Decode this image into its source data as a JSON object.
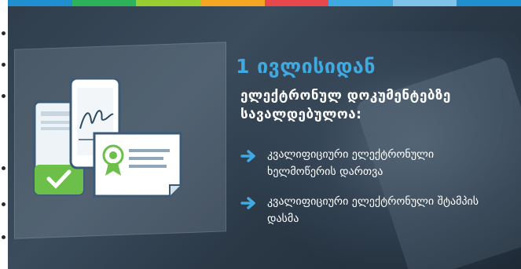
{
  "slide": {
    "title": "1 ივლისიდან",
    "subtitle": "ელექტრონულ დოკუმენტებზე სავალდებულოა:",
    "items": [
      {
        "label": "კვალიფიციური ელექტრონული ხელმოწერის დართვა"
      },
      {
        "label": "კვალიფიციური ელექტრონული შტამპის დასმა"
      }
    ],
    "accent_color": "#3fa9e0",
    "stripe_colors": [
      "#1f8fd0",
      "#2db15b",
      "#9acd32",
      "#f5a623",
      "#e8474c",
      "#3fa9e0",
      "#7fc4e8",
      "#1f8fd0"
    ],
    "icons": [
      "document-check-icon",
      "phone-signature-icon",
      "certificate-icon",
      "arrow-right-icon"
    ]
  }
}
